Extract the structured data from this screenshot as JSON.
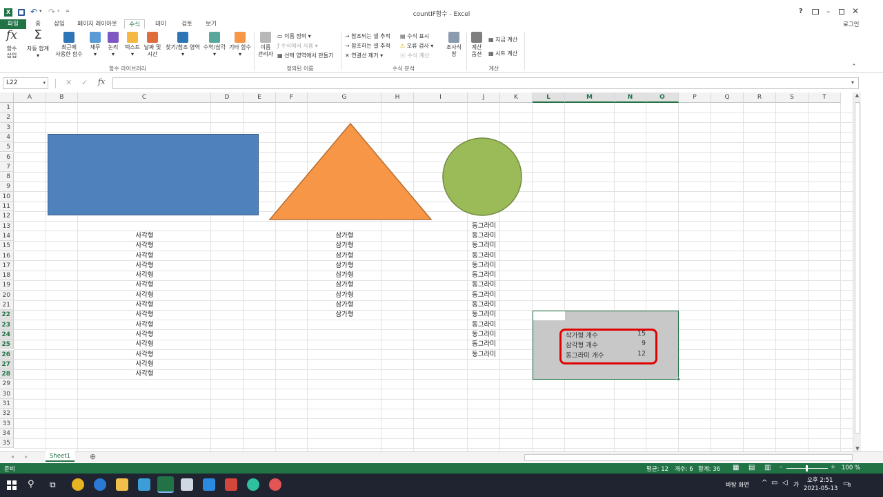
{
  "window": {
    "title": "countIF함수 - Excel",
    "login": "로그인"
  },
  "qat": {
    "save": "save-icon",
    "undo": "undo-icon",
    "redo": "redo-icon"
  },
  "tabs": [
    "파일",
    "홈",
    "삽입",
    "페이지 레이아웃",
    "수식",
    "데이터",
    "검토",
    "보기"
  ],
  "active_tab": "수식",
  "ribbon": {
    "insert_fn": "함수\n삽입",
    "autosum": "자동 합계",
    "recent": "최근에\n사용한 함수",
    "finance": "재무",
    "logic": "논리",
    "text": "텍스트",
    "datetime": "날짜 및\n시간",
    "lookup": "찾기/참조 영역",
    "math": "수학/삼각",
    "more": "기타 함수",
    "group_library": "함수 라이브러리",
    "name_mgr": "이름\n관리자",
    "define_name": "이름 정의",
    "use_in_formula": "수식에서 사용",
    "create_from_sel": "선택 영역에서 만들기",
    "group_names": "정의된 이름",
    "trace_prec": "참조되는 셀 추적",
    "trace_dep": "참조하는 셀 추적",
    "remove_arrows": "연결선 제거",
    "show_formulas": "수식 표시",
    "error_check": "오류 검사",
    "eval_formula": "수식 계산",
    "watch": "조사식\n창",
    "group_audit": "수식 분석",
    "calc_options": "계산\n옵션",
    "calc_now": "지금 계산",
    "calc_sheet": "시트 계산",
    "group_calc": "계산"
  },
  "formula_bar": {
    "name_box": "L22",
    "formula": ""
  },
  "columns": [
    "A",
    "B",
    "C",
    "D",
    "E",
    "F",
    "G",
    "H",
    "I",
    "J",
    "K",
    "L",
    "M",
    "N",
    "O",
    "P",
    "Q",
    "R",
    "S",
    "T"
  ],
  "rows": [
    "1",
    "2",
    "3",
    "4",
    "5",
    "6",
    "7",
    "8",
    "9",
    "10",
    "11",
    "12",
    "13",
    "14",
    "15",
    "16",
    "17",
    "18",
    "19",
    "20",
    "21",
    "22",
    "23",
    "24",
    "25",
    "26",
    "27",
    "28",
    "29",
    "30",
    "31",
    "32",
    "33",
    "34",
    "35"
  ],
  "col_C": [
    "사각형",
    "사각형",
    "사각형",
    "사각형",
    "사각형",
    "사각형",
    "사각형",
    "사각형",
    "사각형",
    "사각형",
    "사각형",
    "사각형",
    "사각형",
    "사각형",
    "사각형"
  ],
  "col_G": [
    "삼가형",
    "삼가형",
    "삼가형",
    "삼가형",
    "삼가형",
    "삼가형",
    "삼가형",
    "삼가형",
    "삼가형"
  ],
  "col_J": [
    "동그라미",
    "동그라미",
    "동그라미",
    "동그라미",
    "동그라미",
    "동그라미",
    "동그라미",
    "동그라미",
    "동그라미",
    "동그라미",
    "동그라미",
    "동그라미",
    "동그라미",
    "동그라미"
  ],
  "summary": [
    {
      "label": "삭가형 개수",
      "value": "15"
    },
    {
      "label": "삼각형 개수",
      "value": "9"
    },
    {
      "label": "동그라미 개수",
      "value": "12"
    }
  ],
  "colors": {
    "rect_fill": "#4f81bd",
    "triangle_fill": "#f79646",
    "circle_fill": "#9bbb59",
    "excel_green": "#217346",
    "highlight": "#e00000"
  },
  "sheet_tab": "Sheet1",
  "status": {
    "ready": "준비",
    "avg": "평균: 12",
    "count": "개수: 6",
    "sum": "합계: 36",
    "zoom": "100 %"
  },
  "taskbar": {
    "desktop": "바탕 화면",
    "ime": "가",
    "time": "오후 2:51",
    "date": "2021-05-13",
    "notif": "8"
  }
}
